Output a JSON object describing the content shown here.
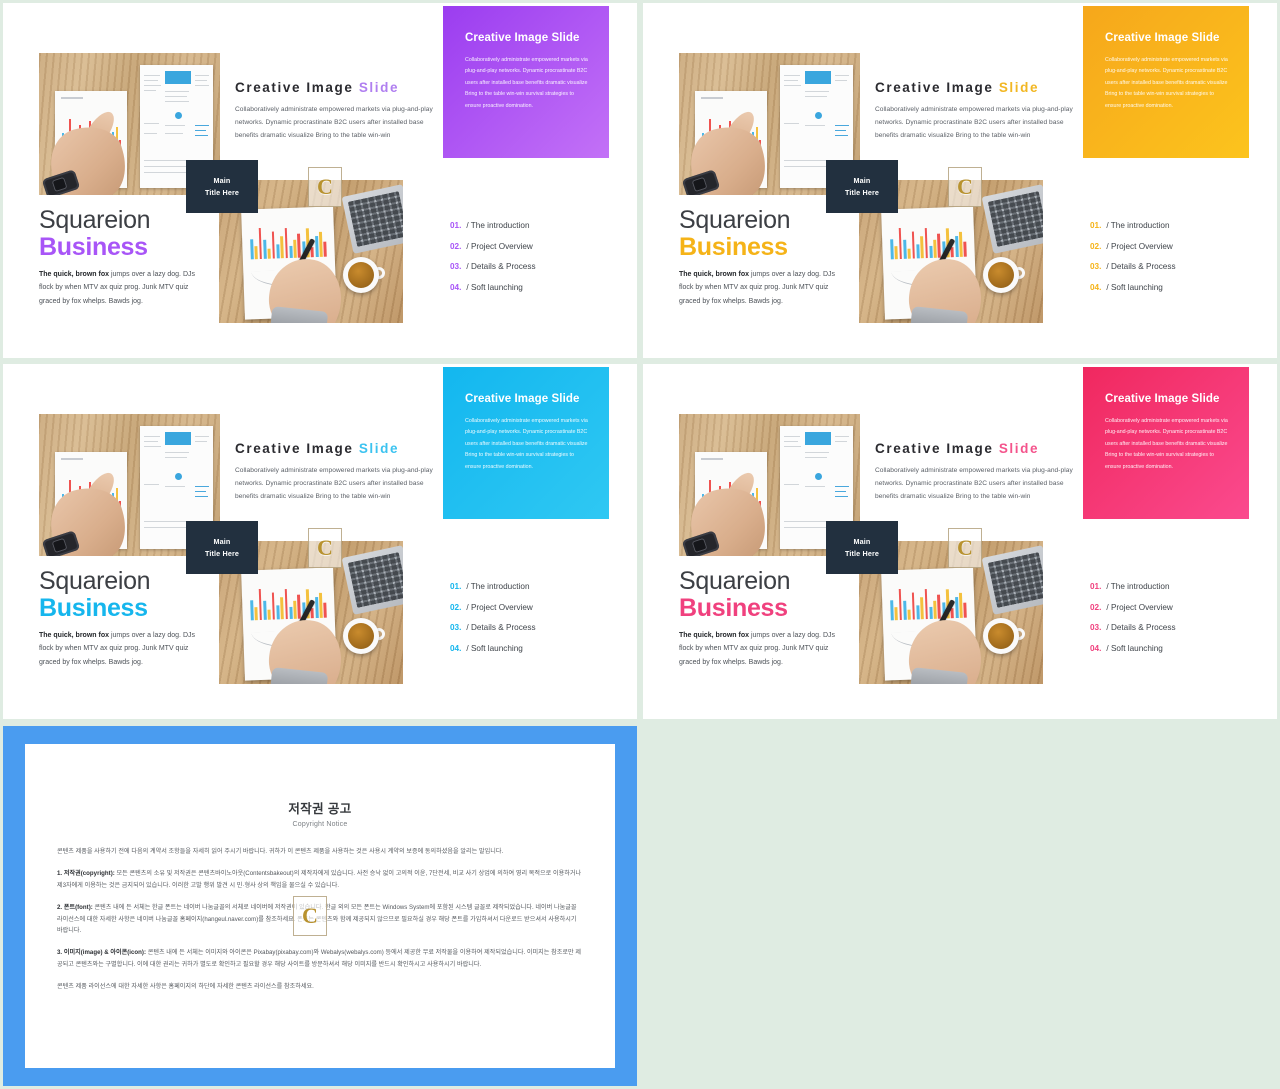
{
  "meta": {
    "page_background": "#dfece2",
    "dark_box_color": "#22303f"
  },
  "slides": [
    {
      "id": "slide-1",
      "accent": "#a855f7",
      "accent_soft": "#b07ff0",
      "gradient_from": "#9b3df0",
      "gradient_to": "#c371f7",
      "headline_main": "Creative Image",
      "headline_accent": "Slide",
      "body": "Collaboratively administrate empowered  markets via plug-and-play networks. Dynamic procrastinate B2C users after installed base benefits dramatic visualize Bring to the  table win-win",
      "card_title": "Creative Image Slide",
      "card_body": "Collaboratively administrate empowered markets via plug-and-play networks. Dynamic procrastinate B2C users after installed base benefits dramatic visualize Bring to the  table win-win survival strategies to ensure proactive domination.",
      "title_box_line1": "Main",
      "title_box_line2": "Title Here",
      "brand_line1": "Squareion",
      "brand_line2": "Business",
      "brand_copy_bold": "The quick, brown fox",
      "brand_copy_rest": " jumps over a lazy dog. DJs flock by when MTV ax quiz prog. Junk MTV quiz graced by fox whelps. Bawds jog.",
      "watermark": "C",
      "agenda": [
        {
          "num": "01.",
          "text": "/ The introduction"
        },
        {
          "num": "02.",
          "text": "/ Project Overview"
        },
        {
          "num": "03.",
          "text": "/ Details & Process"
        },
        {
          "num": "04.",
          "text": "/ Soft launching"
        }
      ]
    },
    {
      "id": "slide-2",
      "accent": "#f5b318",
      "accent_soft": "#f2b723",
      "gradient_from": "#f6a71b",
      "gradient_to": "#fcc41d",
      "headline_main": "Creative Image",
      "headline_accent": "Slide",
      "body": "Collaboratively administrate empowered  markets via plug-and-play networks. Dynamic procrastinate B2C users after installed base benefits dramatic visualize Bring to the  table win-win",
      "card_title": "Creative Image Slide",
      "card_body": "Collaboratively administrate empowered markets via plug-and-play networks. Dynamic procrastinate B2C users after installed base benefits dramatic visualize Bring to the  table win-win survival strategies to ensure proactive domination.",
      "title_box_line1": "Main",
      "title_box_line2": "Title Here",
      "brand_line1": "Squareion",
      "brand_line2": "Business",
      "brand_copy_bold": "The quick, brown fox",
      "brand_copy_rest": " jumps over a lazy dog. DJs flock by when MTV ax quiz prog. Junk MTV quiz graced by fox whelps. Bawds jog.",
      "watermark": "C",
      "agenda": [
        {
          "num": "01.",
          "text": "/ The introduction"
        },
        {
          "num": "02.",
          "text": "/ Project Overview"
        },
        {
          "num": "03.",
          "text": "/ Details & Process"
        },
        {
          "num": "04.",
          "text": "/ Soft launching"
        }
      ]
    },
    {
      "id": "slide-3",
      "accent": "#16b6ed",
      "accent_soft": "#3cc3f0",
      "gradient_from": "#13b7ef",
      "gradient_to": "#2fc8f3",
      "headline_main": "Creative Image",
      "headline_accent": "Slide",
      "body": "Collaboratively administrate empowered markets via plug-and-play networks. Dynamic procrastinate B2C users after installed base benefits dramatic visualize Bring to the  table win-win",
      "card_title": "Creative Image Slide",
      "card_body": "Collaboratively administrate empowered markets via plug-and-play networks. Dynamic procrastinate B2C users after installed base benefits dramatic visualize Bring to the  table win-win survival strategies to ensure proactive domination.",
      "title_box_line1": "Main",
      "title_box_line2": "Title Here",
      "brand_line1": "Squareion",
      "brand_line2": "Business",
      "brand_copy_bold": "The quick, brown fox",
      "brand_copy_rest": " jumps over a lazy dog. DJs flock by when MTV ax quiz prog. Junk MTV quiz graced by fox whelps. Bawds jog.",
      "watermark": "C",
      "agenda": [
        {
          "num": "01.",
          "text": "/ The introduction"
        },
        {
          "num": "02.",
          "text": "/ Project Overview"
        },
        {
          "num": "03.",
          "text": "/ Details & Process"
        },
        {
          "num": "04.",
          "text": "/ Soft launching"
        }
      ]
    },
    {
      "id": "slide-4",
      "accent": "#f0417e",
      "accent_soft": "#f4548c",
      "gradient_from": "#f0285f",
      "gradient_to": "#fb4a8e",
      "headline_main": "Creative Image",
      "headline_accent": "Slide",
      "body": "Collaboratively administrate empowered  markets via plug-and-play networks. Dynamic procrastinate B2C users after installed base benefits dramatic visualize Bring to the  table win-win",
      "card_title": "Creative Image Slide",
      "card_body": "Collaboratively administrate empowered markets via plug-and-play networks. Dynamic procrastinate B2C users after installed base benefits dramatic visualize Bring to the  table win-win survival strategies to ensure proactive domination.",
      "title_box_line1": "Main",
      "title_box_line2": "Title Here",
      "brand_line1": "Squareion",
      "brand_line2": "Business",
      "brand_copy_bold": "The quick, brown fox",
      "brand_copy_rest": " jumps over a lazy dog. DJs flock by when MTV ax quiz prog. Junk MTV quiz graced by fox whelps. Bawds jog.",
      "watermark": "C",
      "agenda": [
        {
          "num": "01.",
          "text": "/ The introduction"
        },
        {
          "num": "02.",
          "text": "/ Project Overview"
        },
        {
          "num": "03.",
          "text": "/ Details & Process"
        },
        {
          "num": "04.",
          "text": "/ Soft launching"
        }
      ]
    }
  ],
  "copyright": {
    "frame_color": "#4a9cf0",
    "title_ko": "저작권 공고",
    "title_en": "Copyright Notice",
    "watermark": "C",
    "paragraphs": [
      "콘텐츠 제품을 사용하기 전에 다음의 계약서 조항들을 자세히 읽어 주시기 바랍니다. 귀하가 이 콘텐츠 제품을 사용하는 것은 사용시 계약의 보증에 동의하셨음을 알리는 말입니다.",
      "1. 저작권(copyright): 모든 콘텐츠의 소유 및 저작권은 콘텐츠바이노아웃(Contentsbakeout)의 제작자에게 있습니다. 사전 승낙 없이 고의적 이윤, 7단전세, 비교 사기 상업에 의하여 영리 목적으로 이용하거나 제3자에게 이용하는 것은 금지되어 있습니다. 이러한 고발 행위 발견 시 민·형사 상의 책임을 물으실 수 있습니다.",
      "2. 폰트(font): 콘텐츠 내에 든 서체는 한글 폰트는 네이버 나눔글꼴의 서체로 네이버에 저작권이 있습니다. 한글 외의 모든 폰트는 Windows System에 포함된 시스템 글꼴로 제작되었습니다. 네이버 나눔글꼴 라이선스에 대한 자세한 사항은 네이버 나눔글꼴 홈페이지(hangeul.naver.com)를 참조하세요. 폰트는 콘텐츠와 함께 제공되지 않으므로 필요하실 경우 해당 폰트를 가입하셔서 다운로드 받으셔서 사용하시기 바랍니다.",
      "3. 이미지(image) & 아이콘(icon): 콘텐츠 내에 든 서체는 이미지와 아이콘은 Pixabay(pixabay.com)와 Webalys(webalys.com) 등에서 제공한 무료 저작물을 이용하여 제작되었습니다. 이미지는 참조로만 제공되고 콘텐츠와는 구별합니다. 이에 대한 권리는 귀하가 별도로 확인하고 필요할 경우 해당 사이트를 방문하셔서 해당 이미지를 반드시 확인하시고 사용하시기 바랍니다.",
      "콘텐츠 제품 라이선스에 대한 자세한 사항은 홈페이지의 하단에 자세한 콘텐츠 라이선스를 참조하세요."
    ]
  }
}
